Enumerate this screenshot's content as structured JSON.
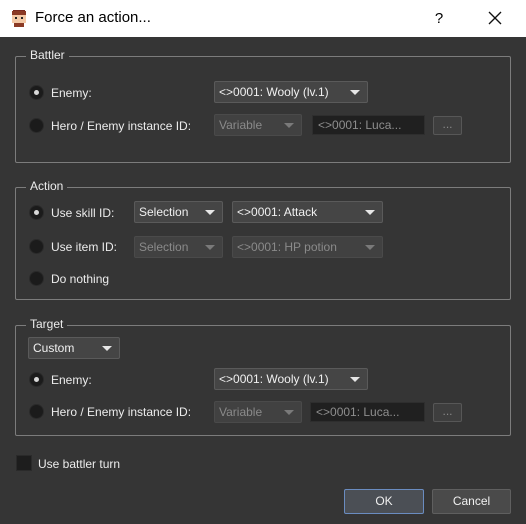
{
  "window": {
    "title": "Force an action...",
    "help": "?"
  },
  "battler": {
    "title": "Battler",
    "enemy_label": "Enemy:",
    "enemy_value": "<>0001: Wooly (lv.1)",
    "instance_label": "Hero / Enemy instance ID:",
    "instance_type": "Variable",
    "instance_field": "<>0001: Luca...",
    "browse": "..."
  },
  "action": {
    "title": "Action",
    "skill_label": "Use skill ID:",
    "skill_mode": "Selection",
    "skill_value": "<>0001: Attack",
    "item_label": "Use item ID:",
    "item_mode": "Selection",
    "item_value": "<>0001: HP potion",
    "nothing_label": "Do nothing"
  },
  "target": {
    "title": "Target",
    "mode": "Custom",
    "enemy_label": "Enemy:",
    "enemy_value": "<>0001: Wooly (lv.1)",
    "instance_label": "Hero / Enemy instance ID:",
    "instance_type": "Variable",
    "instance_field": "<>0001: Luca...",
    "browse": "..."
  },
  "options": {
    "battler_turn_label": "Use battler turn"
  },
  "buttons": {
    "ok": "OK",
    "cancel": "Cancel"
  }
}
